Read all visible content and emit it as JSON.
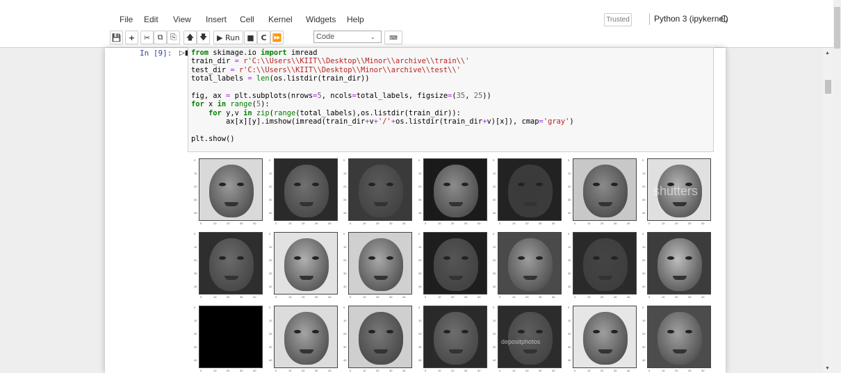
{
  "menu": {
    "items": [
      "File",
      "Edit",
      "View",
      "Insert",
      "Cell",
      "Kernel",
      "Widgets",
      "Help"
    ]
  },
  "status": {
    "trusted": "Trusted",
    "kernel": "Python 3 (ipykernel)"
  },
  "toolbar": {
    "run_label": "Run",
    "cell_type": "Code"
  },
  "cell": {
    "prompt": "In [9]:",
    "code_lines": [
      "from skimage.io import imread",
      "train_dir = r'C:\\\\Users\\\\KIIT\\\\Desktop\\\\Minor\\\\archive\\\\train\\\\'",
      "test_dir = r'C:\\\\Users\\\\KIIT\\\\Desktop\\\\Minor\\\\archive\\\\test\\\\'",
      "total_labels = len(os.listdir(train_dir))",
      "",
      "fig, ax = plt.subplots(nrows=5, ncols=total_labels, figsize=(35, 25))",
      "for x in range(5):",
      "    for y,v in zip(range(total_labels),os.listdir(train_dir)):",
      "        ax[x][y].imshow(imread(train_dir+v+'/'+os.listdir(train_dir+v)[x]), cmap='gray')",
      "",
      "plt.show()"
    ]
  },
  "output": {
    "rows": 3,
    "cols": 7,
    "watermarks": [
      "shutters",
      "depositphotos"
    ],
    "tick_labels": [
      "0",
      "10",
      "20",
      "30",
      "40"
    ]
  }
}
